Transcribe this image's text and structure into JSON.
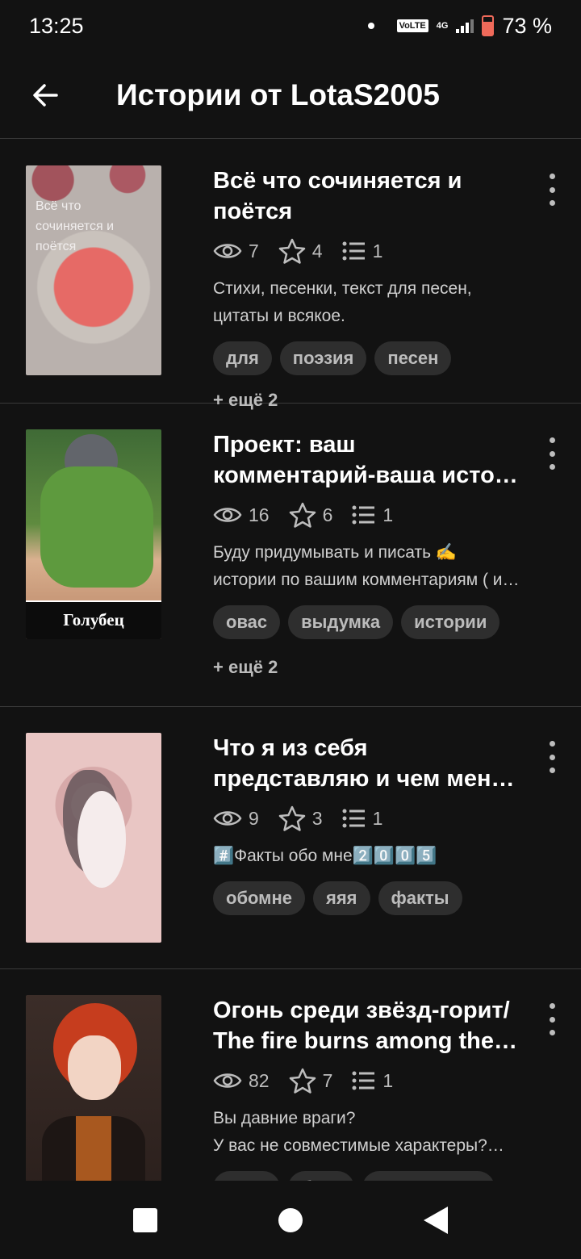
{
  "status": {
    "time": "13:25",
    "volte": "VoLTE",
    "network": "4G",
    "battery": "73 %",
    "battery_level": 0.73
  },
  "header": {
    "title": "Истории от LotaS2005"
  },
  "stories": [
    {
      "title": "Всё что сочиняется и поётся",
      "views": "7",
      "votes": "4",
      "parts": "1",
      "description": "Стихи, песенки, текст для песен, цитаты и всякое.",
      "tags": [
        "для",
        "поэзия",
        "песен"
      ],
      "more_tags": "+ ещё 2",
      "cover_text": "Всё что сочиняется и поётся"
    },
    {
      "title": "Проект: ваш комментарий-ваша исто…",
      "views": "16",
      "votes": "6",
      "parts": "1",
      "description": "Буду придумывать и писать ✍️ истории по вашим комментариям ( и …",
      "tags": [
        "овас",
        "выдумка",
        "истории"
      ],
      "more_tags": "+ ещё 2",
      "cover_text": "Голубец"
    },
    {
      "title": "Что я из себя представляю и чем меня …",
      "views": "9",
      "votes": "3",
      "parts": "1",
      "description": "#️⃣Факты обо мне2️⃣0️⃣0️⃣5️⃣",
      "tags": [
        "обомне",
        "яяя",
        "факты"
      ],
      "more_tags": "",
      "cover_text": ""
    },
    {
      "title": "Огонь среди звёзд-горит/ The fire burns among the s…",
      "views": "82",
      "votes": "7",
      "parts": "1",
      "description": "Вы давние враги?\nУ вас не совместимые характеры?…",
      "tags": [
        "доти",
        "брак",
        "розница в…"
      ],
      "more_tags": "",
      "cover_text": ""
    }
  ],
  "icons": {
    "back": "arrow-left-icon",
    "views": "eye-icon",
    "votes": "star-icon",
    "parts": "list-icon",
    "menu": "more-vertical-icon"
  }
}
